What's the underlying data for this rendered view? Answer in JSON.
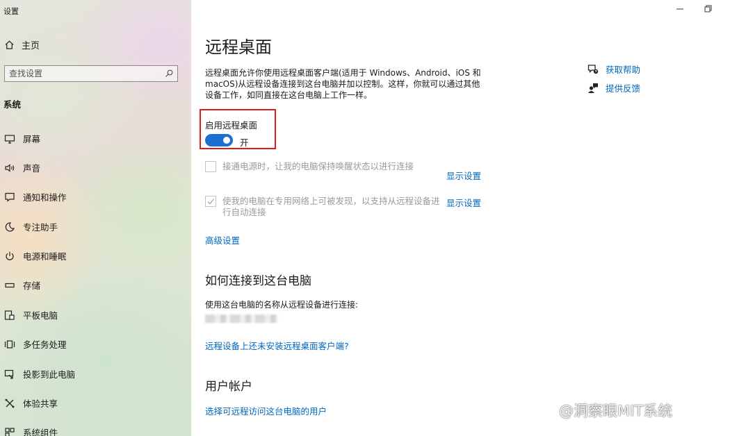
{
  "window": {
    "title": "设置",
    "min_icon": "minimize-icon",
    "max_icon": "maximize-icon"
  },
  "sidebar": {
    "home_label": "主页",
    "search_placeholder": "查找设置",
    "section_label": "系统",
    "items": [
      {
        "label": "屏幕",
        "icon": "monitor-icon"
      },
      {
        "label": "声音",
        "icon": "speaker-icon"
      },
      {
        "label": "通知和操作",
        "icon": "notification-icon"
      },
      {
        "label": "专注助手",
        "icon": "moon-icon"
      },
      {
        "label": "电源和睡眠",
        "icon": "power-icon"
      },
      {
        "label": "存储",
        "icon": "storage-icon"
      },
      {
        "label": "平板电脑",
        "icon": "tablet-icon"
      },
      {
        "label": "多任务处理",
        "icon": "multitask-icon"
      },
      {
        "label": "投影到此电脑",
        "icon": "project-icon"
      },
      {
        "label": "体验共享",
        "icon": "share-icon"
      },
      {
        "label": "系统组件",
        "icon": "components-icon"
      }
    ]
  },
  "main": {
    "title": "远程桌面",
    "description": "远程桌面允许你使用远程桌面客户端(适用于 Windows、Android、iOS 和 macOS)从远程设备连接到这台电脑并加以控制。这样，你就可以通过其他设备工作，如同直接在这台电脑上工作一样。",
    "toggle": {
      "label": "启用远程桌面",
      "state": "开",
      "on": true
    },
    "option1": {
      "text": "接通电源时，让我的电脑保持唤醒状态以进行连接",
      "checked": false,
      "link": "显示设置"
    },
    "option2": {
      "text": "使我的电脑在专用网络上可被发现，以支持从远程设备进行自动连接",
      "checked": true,
      "link": "显示设置"
    },
    "advanced_link": "高级设置",
    "how_heading": "如何连接到这台电脑",
    "how_text": "使用这台电脑的名称从远程设备进行连接:",
    "client_link": "远程设备上还未安装远程桌面客户端?",
    "accounts_heading": "用户帐户",
    "accounts_link": "选择可远程访问这台电脑的用户"
  },
  "help": {
    "get_help": "获取帮助",
    "feedback": "提供反馈"
  },
  "watermark": "@洞察眼MIT系统",
  "colors": {
    "accent": "#0067c0",
    "toggle_on": "#1a6fd1",
    "highlight": "#e11b1b"
  }
}
